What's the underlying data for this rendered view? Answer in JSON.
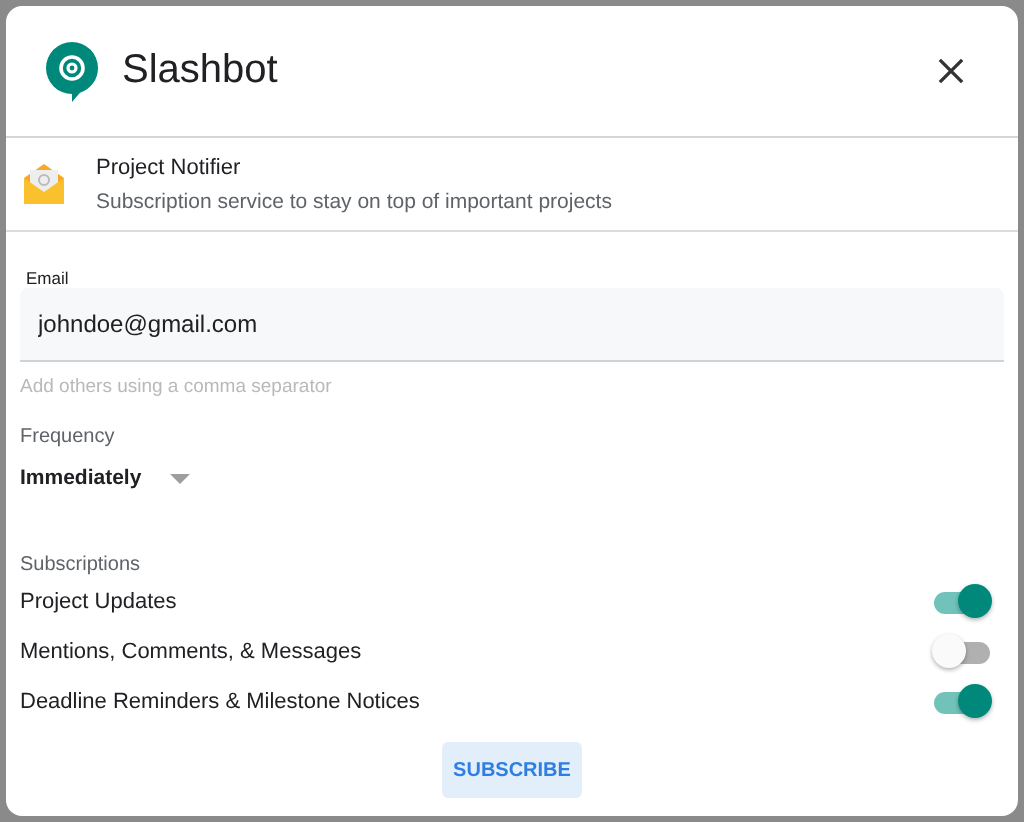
{
  "dialog": {
    "title": "Slashbot"
  },
  "app": {
    "name": "Project Notifier",
    "description": "Subscription service to stay on top of important projects"
  },
  "email": {
    "label": "Email",
    "value": "johndoe@gmail.com",
    "hint": "Add others using a comma separator"
  },
  "frequency": {
    "label": "Frequency",
    "value": "Immediately"
  },
  "subscriptions": {
    "label": "Subscriptions",
    "items": [
      {
        "label": "Project Updates",
        "on": true
      },
      {
        "label": "Mentions, Comments, & Messages",
        "on": false
      },
      {
        "label": "Deadline Reminders & Milestone Notices",
        "on": true
      }
    ]
  },
  "buttons": [
    "SUBSCRIBE"
  ]
}
